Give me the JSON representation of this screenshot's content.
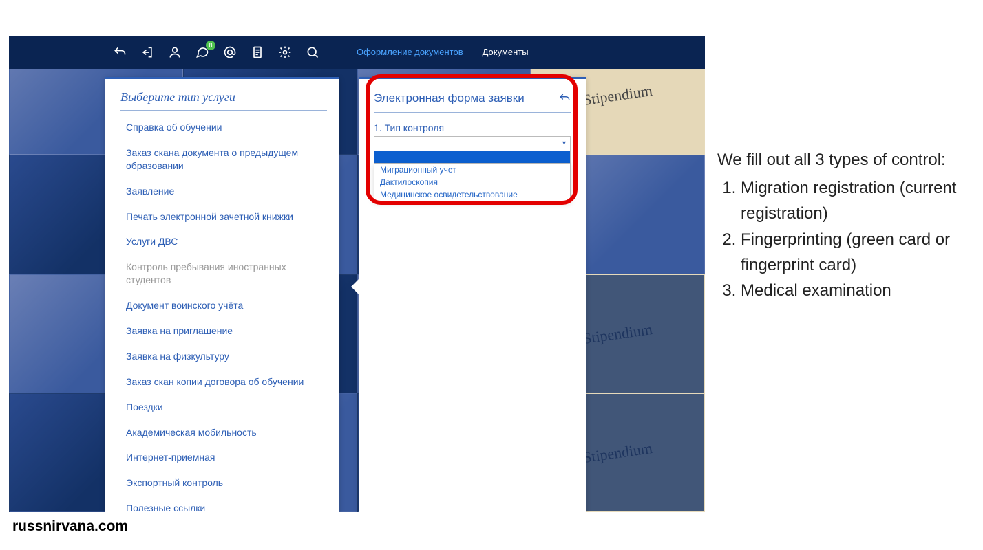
{
  "topbar": {
    "badge": "8",
    "link_active": "Оформление документов",
    "link2": "Документы"
  },
  "panel_left": {
    "title": "Выберите тип услуги",
    "items": [
      "Справка об обучении",
      "Заказ скана документа о предыдущем образовании",
      "Заявление",
      "Печать электронной зачетной книжки",
      "Услуги ДВС",
      "Контроль пребывания иностранных студентов",
      "Документ воинского учёта",
      "Заявка на приглашение",
      "Заявка на физкультуру",
      "Заказ скан копии договора об обучении",
      "Поездки",
      "Академическая мобильность",
      "Интернет-приемная",
      "Экспортный контроль",
      "Полезные ссылки"
    ],
    "selected_index": 5
  },
  "panel_right": {
    "title": "Электронная форма заявки",
    "field_label": "1. Тип контроля",
    "options": [
      "Миграционный учет",
      "Дактилоскопия",
      "Медицинское освидетельствование"
    ]
  },
  "annotation": {
    "intro": "We fill out all 3 types of control:",
    "items": [
      "Migration registration (current registration)",
      "Fingerprinting (green card or fingerprint card)",
      "Medical examination"
    ]
  },
  "watermark": "russnirvana.com"
}
